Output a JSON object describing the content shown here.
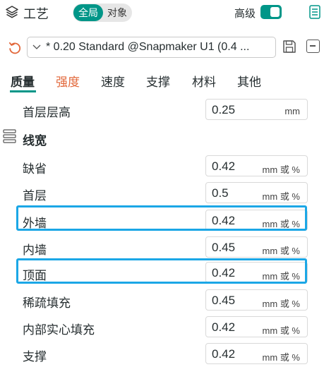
{
  "header": {
    "title": "工艺",
    "segment": {
      "global": "全局",
      "object": "对象"
    },
    "advanced_label": "高级",
    "advanced_on": true
  },
  "preset": {
    "name": "* 0.20 Standard @Snapmaker U1 (0.4 ..."
  },
  "tabs": [
    "质量",
    "强度",
    "速度",
    "支撑",
    "材料",
    "其他"
  ],
  "settings": {
    "first_layer_height": {
      "label": "首层层高",
      "value": "0.25",
      "unit": "mm"
    },
    "group_line_width": "线宽",
    "rows": [
      {
        "label": "缺省",
        "value": "0.42",
        "unit": "mm 或 %"
      },
      {
        "label": "首层",
        "value": "0.5",
        "unit": "mm 或 %"
      },
      {
        "label": "外墙",
        "value": "0.42",
        "unit": "mm 或 %"
      },
      {
        "label": "内墙",
        "value": "0.45",
        "unit": "mm 或 %"
      },
      {
        "label": "顶面",
        "value": "0.42",
        "unit": "mm 或 %"
      },
      {
        "label": "稀疏填充",
        "value": "0.45",
        "unit": "mm 或 %"
      },
      {
        "label": "内部实心填充",
        "value": "0.42",
        "unit": "mm 或 %"
      },
      {
        "label": "支撑",
        "value": "0.42",
        "unit": "mm 或 %"
      }
    ]
  },
  "colors": {
    "accent": "#009688",
    "warning_tab": "#e2673a",
    "highlight": "#1ba7e6"
  }
}
